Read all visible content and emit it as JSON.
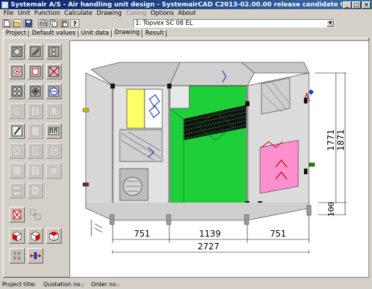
{
  "window": {
    "title": "Systemair A/S - Air handling unit design - SystemairCAD C2013-02.00.00 release candidate 03 -",
    "minimize_label": "_",
    "maximize_label": "□",
    "close_label": "×"
  },
  "menu": {
    "items": [
      {
        "label": "File",
        "enabled": true
      },
      {
        "label": "Unit",
        "enabled": true
      },
      {
        "label": "Function",
        "enabled": true
      },
      {
        "label": "Calculate",
        "enabled": true
      },
      {
        "label": "Drawing",
        "enabled": true
      },
      {
        "label": "Casing",
        "enabled": false
      },
      {
        "label": "Options",
        "enabled": true
      },
      {
        "label": "About",
        "enabled": true
      }
    ]
  },
  "toolbar": {
    "icons": [
      "new-icon",
      "open-icon",
      "save-icon",
      "print-icon",
      "copy-icon",
      "paste-icon",
      "help-icon"
    ],
    "unit_select_value": "1: Topvex SC 08 EL"
  },
  "tabs": [
    {
      "label": "Project",
      "active": false
    },
    {
      "label": "Default values",
      "active": false
    },
    {
      "label": "Unit data",
      "active": false
    },
    {
      "label": "Drawing",
      "active": true
    },
    {
      "label": "Result",
      "active": false
    }
  ],
  "palette": {
    "icons": [
      "section-view-icon",
      "damper-view-icon",
      "fan-view-icon",
      "filter-icon",
      "coil-icon",
      "crossed-panel-icon",
      "heat-exchanger-icon",
      "rotor-icon",
      "fan-module-icon",
      "silencer-icon",
      "split-icon",
      "access-door-icon",
      "diagonal-pipe-icon",
      "blank-module-icon",
      "empty-module-icon",
      "bypass-icon",
      "battery-icon",
      "s-shape-icon",
      "dashed-panel-icon",
      "dashed-grid-icon",
      "dashed-box-icon",
      "section-stack-icon",
      "link-icon",
      "blank-slot-icon",
      "crossed-box-icon",
      "move-icon",
      "blank-slot-icon",
      "cube-red-left-icon",
      "cube-red-front-icon",
      "cube-red-right-icon",
      "split-vertical-icon",
      "connection-arrows-icon",
      "blank-slot-icon"
    ]
  },
  "drawing": {
    "dimensions": {
      "section_left": "751",
      "section_middle": "1139",
      "section_right": "751",
      "total_length": "2727",
      "height_upper": "1771",
      "height_total": "1871",
      "base_height": "100"
    },
    "colors": {
      "casing": "#d7d7d7",
      "green_section": "#1fcf3a",
      "yellow_filter": "#ffff66",
      "pink_filter": "#ff8fcf",
      "coil_pattern": "#111111"
    }
  },
  "statusbar": {
    "project_title_label": "Project title:",
    "quotation_label": "Quotation no.:",
    "order_label": "Order no.:"
  }
}
